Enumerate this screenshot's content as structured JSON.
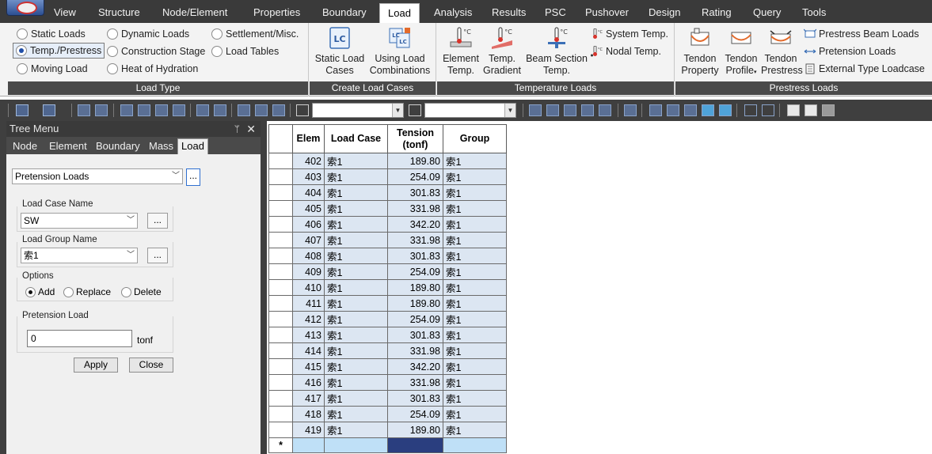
{
  "menubar": {
    "items": [
      "View",
      "Structure",
      "Node/Element",
      "Properties",
      "Boundary",
      "Load",
      "Analysis",
      "Results",
      "PSC",
      "Pushover",
      "Design",
      "Rating",
      "Query",
      "Tools"
    ],
    "active": "Load"
  },
  "ribbon": {
    "load_type": {
      "caption": "Load Type",
      "options": [
        "Static Loads",
        "Temp./Prestress",
        "Moving Load",
        "Dynamic Loads",
        "Construction Stage",
        "Heat of Hydration",
        "Settlement/Misc.",
        "Load Tables"
      ],
      "selected": "Temp./Prestress"
    },
    "create_load_cases": {
      "caption": "Create Load Cases",
      "static_load_cases": [
        "Static Load",
        "Cases"
      ],
      "using_load_combinations": [
        "Using Load",
        "Combinations"
      ]
    },
    "temperature_loads": {
      "caption": "Temperature Loads",
      "element_temp": [
        "Element",
        "Temp."
      ],
      "temp_gradient": [
        "Temp.",
        "Gradient"
      ],
      "beam_section_temp": [
        "Beam Section",
        "Temp."
      ],
      "system_temp": "System Temp.",
      "nodal_temp": "Nodal Temp."
    },
    "prestress_loads": {
      "caption": "Prestress Loads",
      "tendon_property": [
        "Tendon",
        "Property"
      ],
      "tendon_profile": [
        "Tendon",
        "Profile"
      ],
      "tendon_prestress": [
        "Tendon",
        "Prestress"
      ],
      "prestress_beam_loads": "Prestress Beam Loads",
      "pretension_loads": "Pretension Loads",
      "external_type_loadcase": "External Type Loadcase"
    }
  },
  "tree_menu": {
    "title": "Tree Menu",
    "pin_glyph": "ᛘ",
    "close_glyph": "✕",
    "tabs": [
      "Node",
      "Element",
      "Boundary",
      "Mass",
      "Load"
    ],
    "active_tab": "Load",
    "load_type_select": "Pretension Loads",
    "more_button": "...",
    "load_case_name_label": "Load Case Name",
    "load_case_name_value": "SW",
    "load_group_name_label": "Load Group Name",
    "load_group_name_value": "索1",
    "options_label": "Options",
    "options": [
      "Add",
      "Replace",
      "Delete"
    ],
    "options_selected": "Add",
    "pretension_load_label": "Pretension Load",
    "pretension_load_value": "0",
    "pretension_load_unit": "tonf",
    "apply_button": "Apply",
    "close_button": "Close"
  },
  "grid": {
    "columns": [
      "Elem",
      "Load Case",
      "Tension (tonf)",
      "Group"
    ],
    "rows": [
      [
        "402",
        "索1",
        "189.80",
        "索1"
      ],
      [
        "403",
        "索1",
        "254.09",
        "索1"
      ],
      [
        "404",
        "索1",
        "301.83",
        "索1"
      ],
      [
        "405",
        "索1",
        "331.98",
        "索1"
      ],
      [
        "406",
        "索1",
        "342.20",
        "索1"
      ],
      [
        "407",
        "索1",
        "331.98",
        "索1"
      ],
      [
        "408",
        "索1",
        "301.83",
        "索1"
      ],
      [
        "409",
        "索1",
        "254.09",
        "索1"
      ],
      [
        "410",
        "索1",
        "189.80",
        "索1"
      ],
      [
        "411",
        "索1",
        "189.80",
        "索1"
      ],
      [
        "412",
        "索1",
        "254.09",
        "索1"
      ],
      [
        "413",
        "索1",
        "301.83",
        "索1"
      ],
      [
        "414",
        "索1",
        "331.98",
        "索1"
      ],
      [
        "415",
        "索1",
        "342.20",
        "索1"
      ],
      [
        "416",
        "索1",
        "331.98",
        "索1"
      ],
      [
        "417",
        "索1",
        "301.83",
        "索1"
      ],
      [
        "418",
        "索1",
        "254.09",
        "索1"
      ],
      [
        "419",
        "索1",
        "189.80",
        "索1"
      ]
    ],
    "new_row_marker": "*"
  }
}
